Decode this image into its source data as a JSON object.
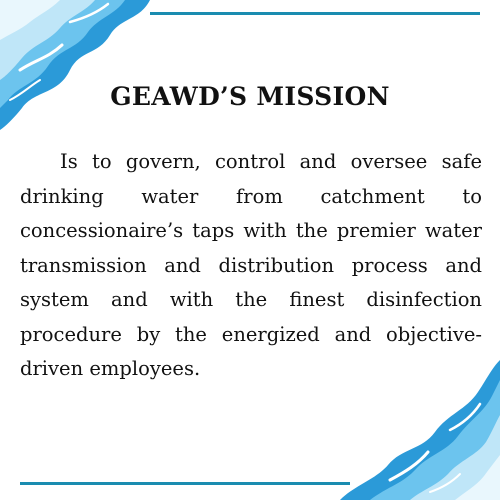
{
  "heading": "GEAWD’S MISSION",
  "mission_text": "Is to govern, control and oversee safe drinking water from catchment to concessionaire’s taps with the premier water transmission and distribution process and system and with the finest disinfection procedure by the energized and objective-driven employees.",
  "colors": {
    "accent_line": "#1a8cb0",
    "wave_light": "#bfe6f8",
    "wave_mid": "#6cc4ee",
    "wave_dark": "#2b9ad8",
    "text": "#111111"
  }
}
